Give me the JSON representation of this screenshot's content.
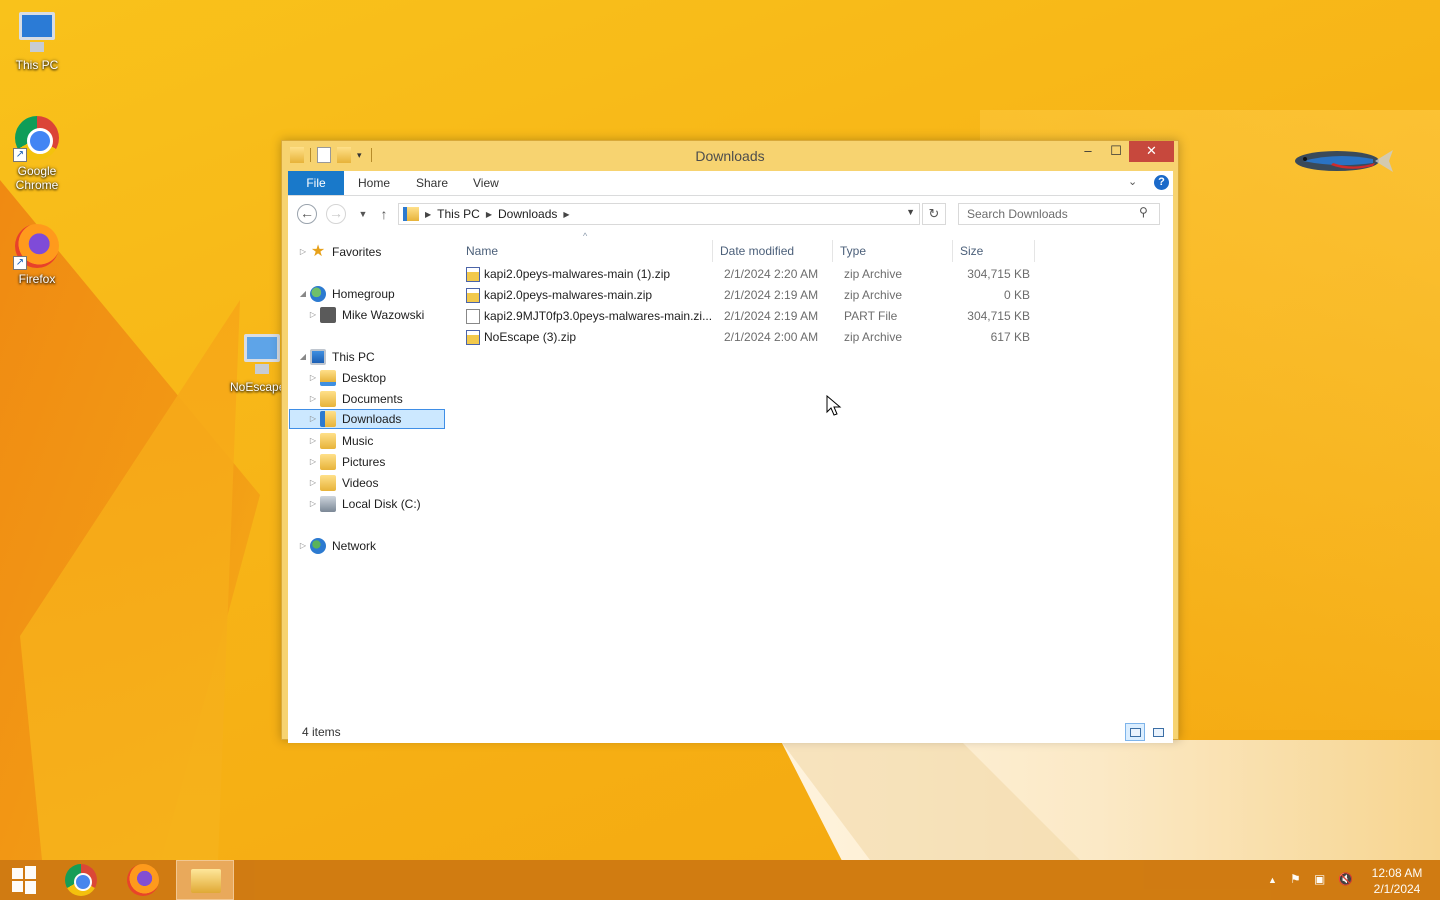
{
  "desktop": {
    "icons": [
      {
        "label": "This PC"
      },
      {
        "label": "Google Chrome"
      },
      {
        "label": "Firefox"
      },
      {
        "label": "NoEscape"
      }
    ]
  },
  "window": {
    "title": "Downloads",
    "controls": {
      "minimize": "–",
      "maximize": "☐",
      "close": "✕"
    },
    "ribbon": {
      "file": "File",
      "home": "Home",
      "share": "Share",
      "view": "View",
      "help": "?"
    },
    "address": {
      "crumbs": [
        "This PC",
        "Downloads"
      ]
    },
    "search": {
      "placeholder": "Search Downloads"
    },
    "nav_tree": [
      {
        "label": "Favorites",
        "icon": "star-icon"
      },
      {
        "label": "Homegroup",
        "icon": "homegroup-icon"
      },
      {
        "label": "Mike Wazowski",
        "icon": "user-icon"
      },
      {
        "label": "This PC",
        "icon": "computer-icon"
      },
      {
        "label": "Desktop",
        "icon": "folder-icon"
      },
      {
        "label": "Documents",
        "icon": "folder-icon"
      },
      {
        "label": "Downloads",
        "icon": "downloads-folder-icon",
        "selected": true
      },
      {
        "label": "Music",
        "icon": "folder-icon"
      },
      {
        "label": "Pictures",
        "icon": "folder-icon"
      },
      {
        "label": "Videos",
        "icon": "folder-icon"
      },
      {
        "label": "Local Disk (C:)",
        "icon": "disk-icon"
      },
      {
        "label": "Network",
        "icon": "network-icon"
      }
    ],
    "columns": {
      "name": "Name",
      "date": "Date modified",
      "type": "Type",
      "size": "Size"
    },
    "files": [
      {
        "name": "kapi2.0peys-malwares-main (1).zip",
        "date": "2/1/2024 2:20 AM",
        "type": "zip Archive",
        "size": "304,715 KB",
        "icon": "zip-file-icon"
      },
      {
        "name": "kapi2.0peys-malwares-main.zip",
        "date": "2/1/2024 2:19 AM",
        "type": "zip Archive",
        "size": "0 KB",
        "icon": "zip-file-icon"
      },
      {
        "name": "kapi2.9MJT0fp3.0peys-malwares-main.zi...",
        "date": "2/1/2024 2:19 AM",
        "type": "PART File",
        "size": "304,715 KB",
        "icon": "blank-file-icon"
      },
      {
        "name": "NoEscape (3).zip",
        "date": "2/1/2024 2:00 AM",
        "type": "zip Archive",
        "size": "617 KB",
        "icon": "zip-file-icon"
      }
    ],
    "status": {
      "count": "4 items"
    }
  },
  "taskbar": {
    "clock": {
      "time": "12:08 AM",
      "date": "2/1/2024"
    }
  },
  "colors": {
    "accent": "#1979ca",
    "wallpaper": "#f7b417",
    "selection": "#cce8ff",
    "close": "#c7483d"
  }
}
